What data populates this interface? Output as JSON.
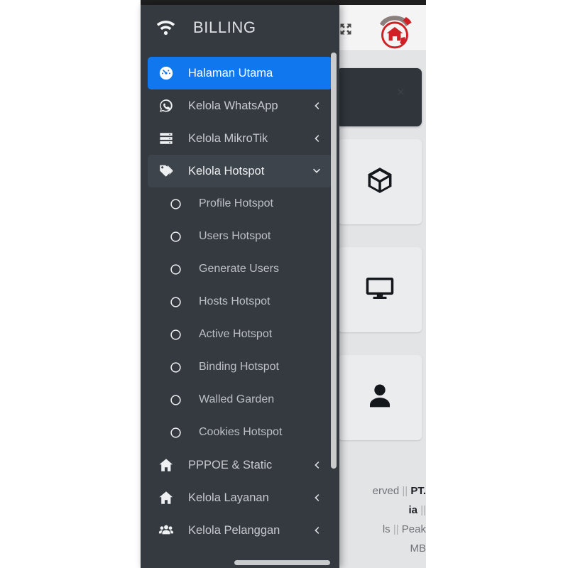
{
  "sidebar": {
    "title": "BILLING",
    "brand_icon": "wifi-icon",
    "accent_color": "#1177ef",
    "background_color": "#343a40",
    "items": [
      {
        "label": "Halaman Utama",
        "icon": "dashboard-icon",
        "state": "active",
        "arrow": ""
      },
      {
        "label": "Kelola WhatsApp",
        "icon": "whatsapp-icon",
        "state": "normal",
        "arrow": "chevron-left-icon"
      },
      {
        "label": "Kelola MikroTik",
        "icon": "server-icon",
        "state": "normal",
        "arrow": "chevron-left-icon"
      },
      {
        "label": "Kelola Hotspot",
        "icon": "tags-icon",
        "state": "open",
        "arrow": "chevron-down-icon"
      }
    ],
    "submenu": [
      {
        "label": "Profile Hotspot",
        "icon": "circle-icon"
      },
      {
        "label": "Users Hotspot",
        "icon": "circle-icon"
      },
      {
        "label": "Generate Users",
        "icon": "circle-icon"
      },
      {
        "label": "Hosts Hotspot",
        "icon": "circle-icon"
      },
      {
        "label": "Active Hotspot",
        "icon": "circle-icon"
      },
      {
        "label": "Binding Hotspot",
        "icon": "circle-icon"
      },
      {
        "label": "Walled Garden",
        "icon": "circle-icon"
      },
      {
        "label": "Cookies Hotspot",
        "icon": "circle-icon"
      }
    ],
    "items_bottom": [
      {
        "label": "PPPOE & Static",
        "icon": "home-icon",
        "arrow": "chevron-left-icon"
      },
      {
        "label": "Kelola Layanan",
        "icon": "home-icon",
        "arrow": "chevron-left-icon"
      },
      {
        "label": "Kelola Pelanggan",
        "icon": "users-group-icon",
        "arrow": "chevron-left-icon"
      }
    ]
  },
  "topbar": {
    "expand_icon": "expand-arrows-icon",
    "logo_icon": "house-wifi-logo"
  },
  "content": {
    "dark_card": {
      "close_icon": "close-icon"
    },
    "tiles": [
      {
        "icon": "cube-icon"
      },
      {
        "icon": "monitor-icon"
      },
      {
        "icon": "user-icon"
      }
    ]
  },
  "footer": {
    "line1_text": "erved",
    "line1_sep": "||",
    "line1_strong": "PT.",
    "line2_strong": "ia",
    "line2_sep": "||",
    "line3_text": "ls",
    "line3_sep": "||",
    "line3_tail": "Peak",
    "line4_text": "MB"
  }
}
